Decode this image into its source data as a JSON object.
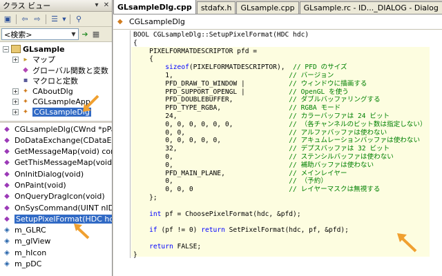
{
  "left_pane": {
    "title": "クラス ビュー",
    "pin_glyph": "▾",
    "close_glyph": "✕",
    "search_placeholder": "<検索>"
  },
  "class_tree": [
    {
      "label": "GLsample",
      "expander": "−",
      "icon": "project-icon",
      "bold": true,
      "indent": 0
    },
    {
      "label": "マップ",
      "expander": "+",
      "icon": "folder-icon",
      "indent": 1
    },
    {
      "label": "グローバル関数と変数",
      "expander": "",
      "icon": "globe-icon",
      "indent": 1
    },
    {
      "label": "マクロと定数",
      "expander": "",
      "icon": "macro-icon",
      "indent": 1
    },
    {
      "label": "CAboutDlg",
      "expander": "+",
      "icon": "class-icon",
      "indent": 1
    },
    {
      "label": "CGLsampleApp",
      "expander": "+",
      "icon": "class-icon",
      "indent": 1
    },
    {
      "label": "CGLsampleDlg",
      "expander": "+",
      "icon": "class-icon",
      "indent": 1,
      "selected": true
    }
  ],
  "members": [
    {
      "label": "CGLsampleDlg(CWnd *pPar",
      "kind": "function"
    },
    {
      "label": "DoDataExchange(CDataExc",
      "kind": "function"
    },
    {
      "label": "GetMessageMap(void) const",
      "kind": "function"
    },
    {
      "label": "GetThisMessageMap(void)",
      "kind": "function"
    },
    {
      "label": "OnInitDialog(void)",
      "kind": "function"
    },
    {
      "label": "OnPaint(void)",
      "kind": "function"
    },
    {
      "label": "OnQueryDragIcon(void)",
      "kind": "function"
    },
    {
      "label": "OnSysCommand(UINT nID,",
      "kind": "function"
    },
    {
      "label": "SetupPixelFormat(HDC hdc",
      "kind": "function",
      "selected": true
    },
    {
      "label": "m_GLRC",
      "kind": "variable"
    },
    {
      "label": "m_glView",
      "kind": "variable"
    },
    {
      "label": "m_hIcon",
      "kind": "variable"
    },
    {
      "label": "m_pDC",
      "kind": "variable"
    }
  ],
  "tabs": [
    {
      "label": "GLsampleDlg.cpp",
      "active": true
    },
    {
      "label": "stdafx.h"
    },
    {
      "label": "GLsample.cpp"
    },
    {
      "label": "GLsample.rc - ID..._DIALOG - Dialog"
    }
  ],
  "editor": {
    "nav_label": "CGLsampleDlg"
  },
  "code_lines": [
    "BOOL CGLsampleDlg::SetupPixelFormat(HDC hdc)",
    "{",
    "    PIXELFORMATDESCRIPTOR pfd =",
    "    {",
    "        @@sizeof@@(PIXELFORMATDESCRIPTOR),  ##// PFD のサイズ##",
    "        1,                             ##// バージョン##",
    "        PFD_DRAW_TO_WINDOW |           ##// ウィンドウに描画する##",
    "        PFD_SUPPORT_OPENGL |           ##// OpenGL を使う##",
    "        PFD_DOUBLEBUFFER,              ##// ダブルバッファリングする##",
    "        PFD_TYPE_RGBA,                 ##// RGBA モード##",
    "        24,                            ##// カラーバッファは 24 ビット##",
    "        0, 0, 0, 0, 0, 0,              ##// （各チャンネルのビット数は指定しない）##",
    "        0, 0,                          ##// アルファバッファは使わない##",
    "        0, 0, 0, 0, 0,                 ##// アキュムレーションバッファは使わない##",
    "        32,                            ##// デプスバッファは 32 ビット##",
    "        0,                             ##// ステンシルバッファは使わない##",
    "        0,                             ##// 補助バッファは使わない##",
    "        PFD_MAIN_PLANE,                ##// メインレイヤー##",
    "        0,                             ##// （予約）##",
    "        0, 0, 0                        ##// レイヤーマスクは無視する##",
    "    };",
    "",
    "    @@int@@ pf = ChoosePixelFormat(hdc, &pfd);",
    "",
    "    @@if@@ (pf != 0) @@return@@ SetPixelFormat(hdc, pf, &pfd);",
    "",
    "    @@return@@ FALSE;",
    "}"
  ],
  "colors": {
    "keyword": "#0000ff",
    "comment": "#008000",
    "highlight": "#fdfde0",
    "selection": "#316ac5",
    "arrow": "#f0a030"
  }
}
